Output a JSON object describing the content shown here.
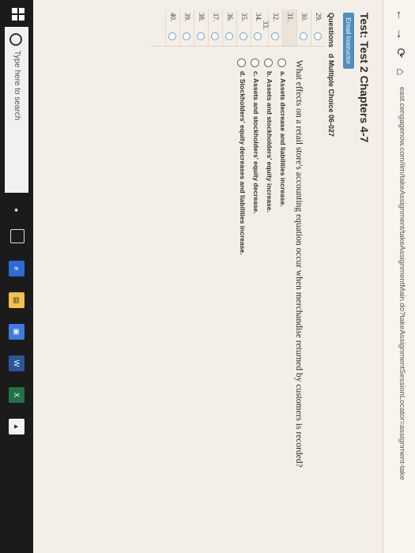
{
  "browser": {
    "back_icon": "←",
    "forward_icon": "→",
    "refresh_icon": "⟳",
    "home_icon": "⌂",
    "url": "east.cengagenow.com/ilrn/takeAssignment/takeAssignmentMain.do?takeAssignmentSessionLocator=assignment-take"
  },
  "page": {
    "test_title": "Test: Test 2 Chapters 4-7",
    "email_instructor": "Email Instructor",
    "questions_label": "Questions",
    "question_type": "d Multiple Choice 06-027"
  },
  "question_nav": [
    {
      "num": "29."
    },
    {
      "num": "30."
    },
    {
      "num": "31."
    },
    {
      "num": "32."
    },
    {
      "num": "33."
    },
    {
      "num": "34."
    },
    {
      "num": "35."
    },
    {
      "num": "36."
    },
    {
      "num": "37."
    },
    {
      "num": "38."
    },
    {
      "num": "39."
    },
    {
      "num": "40."
    }
  ],
  "question": {
    "text": "What effects on a retail store's accounting equation occur when merchandise returned by customers is recorded?",
    "options": [
      {
        "label": "a. Assets decrease and liabilities increase."
      },
      {
        "label": "b. Assets and stockholders' equity increase."
      },
      {
        "label": "c. Assets and stockholders' equity decrease."
      },
      {
        "label": "d. Stockholders' equity decreases and liabilities increase."
      }
    ]
  },
  "taskbar": {
    "search_placeholder": "Type here to search",
    "start_icon": "windows-icon",
    "apps": [
      "task-view-icon",
      "edge-icon",
      "file-explorer-icon",
      "store-icon",
      "word-icon",
      "excel-icon",
      "photos-icon"
    ]
  },
  "colors": {
    "accent": "#4d8fbd",
    "taskbar": "#1b1b1b"
  }
}
